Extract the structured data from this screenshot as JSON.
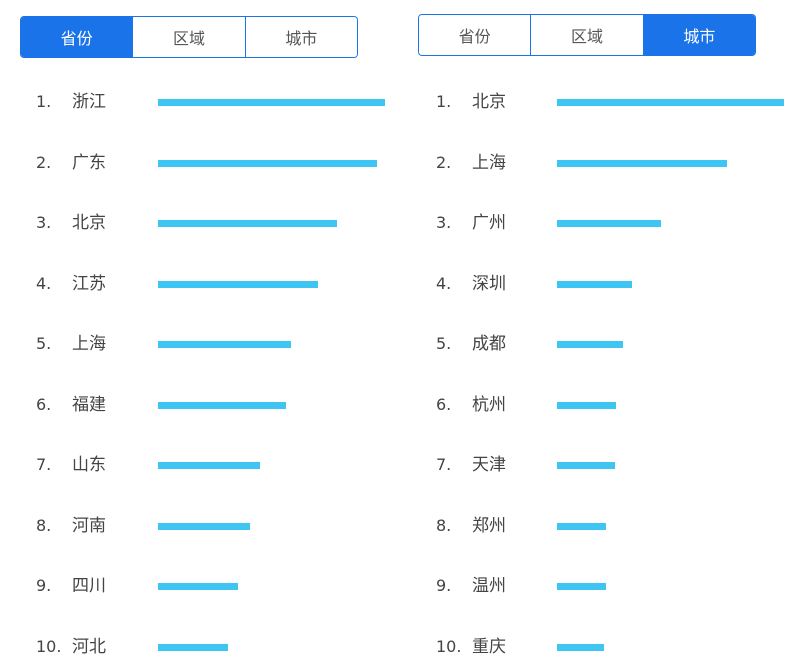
{
  "bar_color": "#3ec5f1",
  "accent_color": "#1a73e8",
  "left_panel": {
    "tabs": [
      {
        "label": "省份",
        "active": true
      },
      {
        "label": "区域",
        "active": false
      },
      {
        "label": "城市",
        "active": false
      }
    ],
    "items": [
      {
        "rank": "1.",
        "name": "浙江",
        "value": 1.0
      },
      {
        "rank": "2.",
        "name": "广东",
        "value": 0.965
      },
      {
        "rank": "3.",
        "name": "北京",
        "value": 0.788
      },
      {
        "rank": "4.",
        "name": "江苏",
        "value": 0.704
      },
      {
        "rank": "5.",
        "name": "上海",
        "value": 0.584
      },
      {
        "rank": "6.",
        "name": "福建",
        "value": 0.562
      },
      {
        "rank": "7.",
        "name": "山东",
        "value": 0.451
      },
      {
        "rank": "8.",
        "name": "河南",
        "value": 0.407
      },
      {
        "rank": "9.",
        "name": "四川",
        "value": 0.354
      },
      {
        "rank": "10.",
        "name": "河北",
        "value": 0.31
      }
    ]
  },
  "right_panel": {
    "tabs": [
      {
        "label": "省份",
        "active": false
      },
      {
        "label": "区域",
        "active": false
      },
      {
        "label": "城市",
        "active": true
      }
    ],
    "items": [
      {
        "rank": "1.",
        "name": "北京",
        "value": 1.0
      },
      {
        "rank": "2.",
        "name": "上海",
        "value": 0.749
      },
      {
        "rank": "3.",
        "name": "广州",
        "value": 0.458
      },
      {
        "rank": "4.",
        "name": "深圳",
        "value": 0.33
      },
      {
        "rank": "5.",
        "name": "成都",
        "value": 0.291
      },
      {
        "rank": "6.",
        "name": "杭州",
        "value": 0.26
      },
      {
        "rank": "7.",
        "name": "天津",
        "value": 0.256
      },
      {
        "rank": "8.",
        "name": "郑州",
        "value": 0.216
      },
      {
        "rank": "9.",
        "name": "温州",
        "value": 0.216
      },
      {
        "rank": "10.",
        "name": "重庆",
        "value": 0.207
      }
    ]
  }
}
